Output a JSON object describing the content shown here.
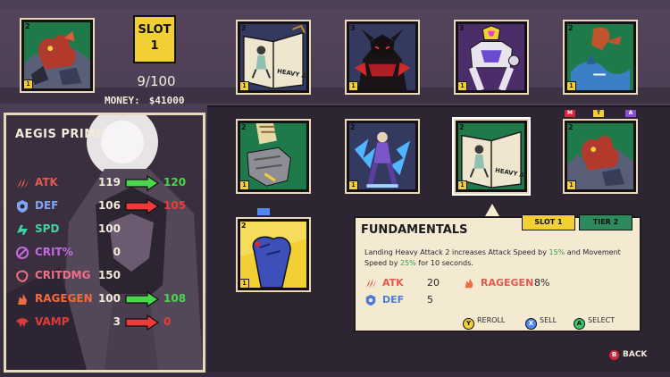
{
  "slot": {
    "line1": "SLOT",
    "line2": "1"
  },
  "inventory": {
    "count": "9/100",
    "money_label": "MONEY:",
    "money_value": "$41000"
  },
  "hero": {
    "name": "AEGIS PRIME",
    "stats": [
      {
        "name": "ATK",
        "value": "119",
        "new_value": "120",
        "change": "up",
        "icon": "claw-icon"
      },
      {
        "name": "DEF",
        "value": "106",
        "new_value": "105",
        "change": "down",
        "icon": "shield-icon"
      },
      {
        "name": "SPD",
        "value": "100",
        "new_value": "",
        "change": "none",
        "icon": "speed-icon"
      },
      {
        "name": "CRIT%",
        "value": "0",
        "new_value": "",
        "change": "none",
        "icon": "crit-icon"
      },
      {
        "name": "CRITDMG",
        "value": "150",
        "new_value": "",
        "change": "none",
        "icon": "critdmg-icon"
      },
      {
        "name": "RAGEGEN",
        "value": "100",
        "new_value": "108",
        "change": "up",
        "icon": "rage-icon"
      },
      {
        "name": "VAMP",
        "value": "3",
        "new_value": "0",
        "change": "down",
        "icon": "vamp-icon"
      }
    ]
  },
  "cards": [
    {
      "tier": "2",
      "level": "1",
      "art": "beast-warriors-art",
      "frame": "green"
    },
    {
      "tier": "2",
      "level": "1",
      "art": "heavy-attack-book-art",
      "frame": "blue"
    },
    {
      "tier": "3",
      "level": "1",
      "art": "red-demon-art",
      "frame": "blue"
    },
    {
      "tier": "3",
      "level": "1",
      "art": "armored-robot-art",
      "frame": "purple"
    },
    {
      "tier": "2",
      "level": "1",
      "art": "wolf-shark-art",
      "frame": "green"
    },
    {
      "tier": "2",
      "level": "1",
      "art": "robot-fist-art",
      "frame": "green"
    },
    {
      "tier": "2",
      "level": "1",
      "art": "lightning-warrior-art",
      "frame": "blue"
    },
    {
      "tier": "2",
      "level": "1",
      "art": "heavy-attack-book-art",
      "frame": "green"
    },
    {
      "tier": "2",
      "level": "1",
      "art": "beast-warriors-art",
      "frame": "green"
    },
    {
      "tier": "2",
      "level": "1",
      "art": "blue-fist-art",
      "frame": "green"
    }
  ],
  "book_caption": "HEAVY ATTACK",
  "card_tags": {
    "m": "M",
    "t": "T",
    "a": "A"
  },
  "tooltip": {
    "title": "FUNDAMENTALS",
    "slot_badge": "SLOT 1",
    "tier_badge": "TIER 2",
    "desc_1": "Landing Heavy Attack 2 increases Attack Speed by ",
    "desc_hi_1": "15%",
    "desc_2": " and Movement Speed by ",
    "desc_hi_2": "25%",
    "desc_3": " for 10 seconds.",
    "stats": [
      {
        "name": "ATK",
        "value": "20"
      },
      {
        "name": "DEF",
        "value": "5"
      },
      {
        "name": "RAGEGEN",
        "value": "8%"
      }
    ],
    "buttons": [
      {
        "key": "Y",
        "label": "REROLL",
        "color": "#f2cf35"
      },
      {
        "key": "X",
        "label": "SELL",
        "color": "#4f88f0"
      },
      {
        "key": "A",
        "label": "SELECT",
        "color": "#3fc46b"
      }
    ]
  },
  "back": {
    "key": "B",
    "label": "BACK"
  }
}
